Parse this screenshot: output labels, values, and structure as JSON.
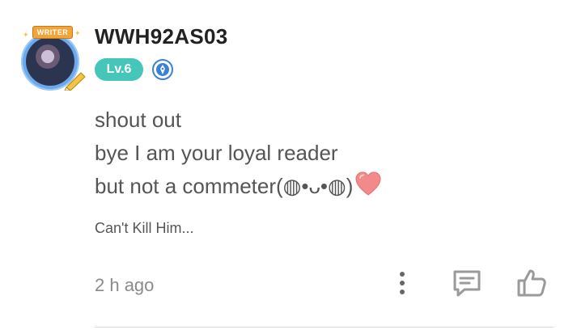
{
  "user": {
    "name": "WWH92AS03",
    "avatar_badge": "WRITER",
    "level": "Lv.6",
    "verified_icon": "verified-pen-icon"
  },
  "comment": {
    "lines": [
      "shout out",
      "bye I am your loyal reader",
      "but not a commeter(◍•ᴗ•◍)"
    ],
    "emoji": "heart-icon"
  },
  "story_title": "Can't Kill Him...",
  "timestamp": "2 h ago",
  "actions": {
    "more": "more-vertical-icon",
    "reply": "reply-icon",
    "like": "thumbs-up-icon"
  },
  "colors": {
    "level_badge": "#45c6b8",
    "verified_badge": "#3b82d6",
    "icon_gray": "#9a9a9a",
    "heart": "#f28a8a"
  }
}
